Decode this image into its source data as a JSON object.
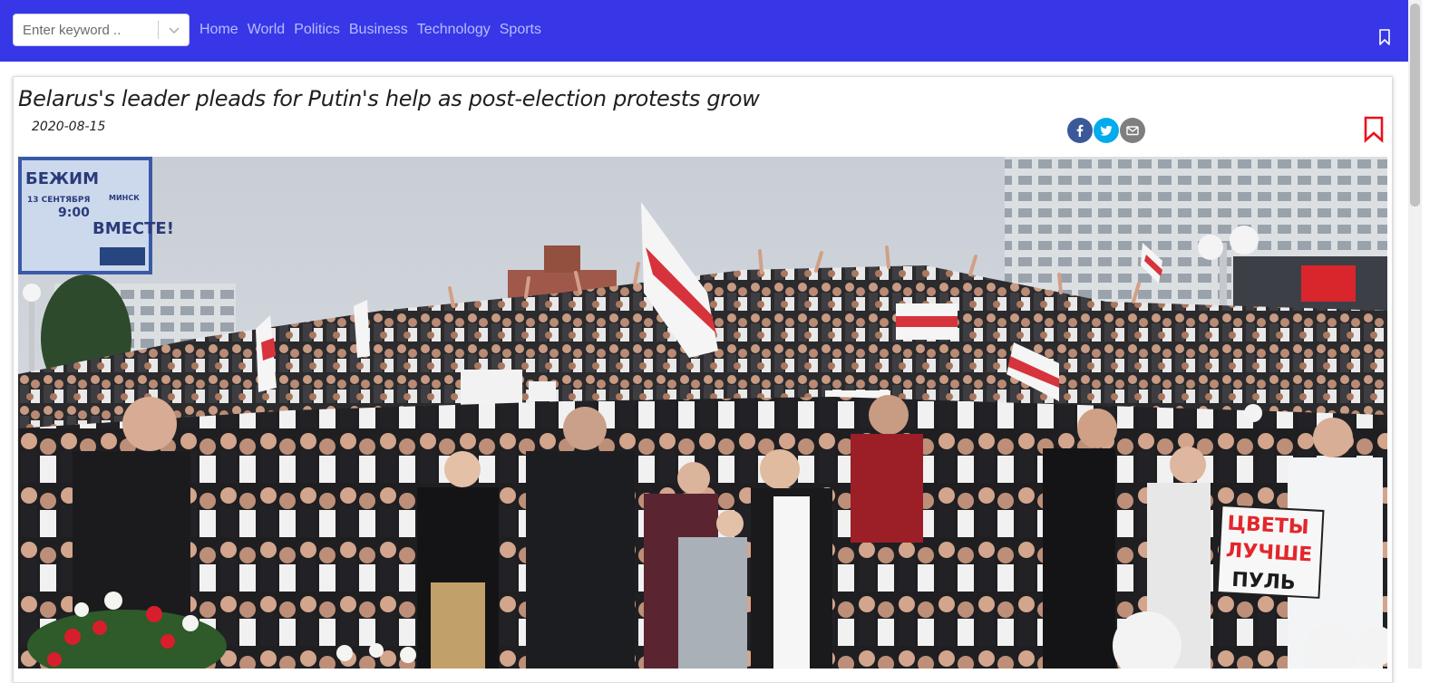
{
  "search": {
    "placeholder": "Enter keyword .."
  },
  "nav": {
    "links": [
      {
        "label": "Home"
      },
      {
        "label": "World"
      },
      {
        "label": "Politics"
      },
      {
        "label": "Business"
      },
      {
        "label": "Technology"
      },
      {
        "label": "Sports"
      }
    ],
    "bookmark_icon": "bookmark-outline-icon"
  },
  "article": {
    "title": "Belarus's leader pleads for Putin's help as post-election protests grow",
    "date": "2020-08-15",
    "share": [
      {
        "network": "facebook",
        "icon": "facebook-icon",
        "color": "#3b5998"
      },
      {
        "network": "twitter",
        "icon": "twitter-icon",
        "color": "#00aced"
      },
      {
        "network": "email",
        "icon": "email-icon",
        "color": "#7f7f7f"
      }
    ],
    "bookmark_icon": "bookmark-icon",
    "bookmark_color": "#e8141d",
    "image": {
      "alt": "Crowd of protesters waving white-red-white flags in Minsk",
      "sign_lines": [
        "ЦВЕТЫ",
        "ЛУЧШЕ",
        "ПУЛЬ"
      ],
      "billboard_lines": [
        "БЕЖИМ",
        "ВМЕСТЕ!",
        "13 СЕНТЯБРЯ",
        "МИНСК",
        "9:00"
      ]
    }
  },
  "colors": {
    "navbar": "#3737e8",
    "nav_link": "#b9bcff"
  }
}
